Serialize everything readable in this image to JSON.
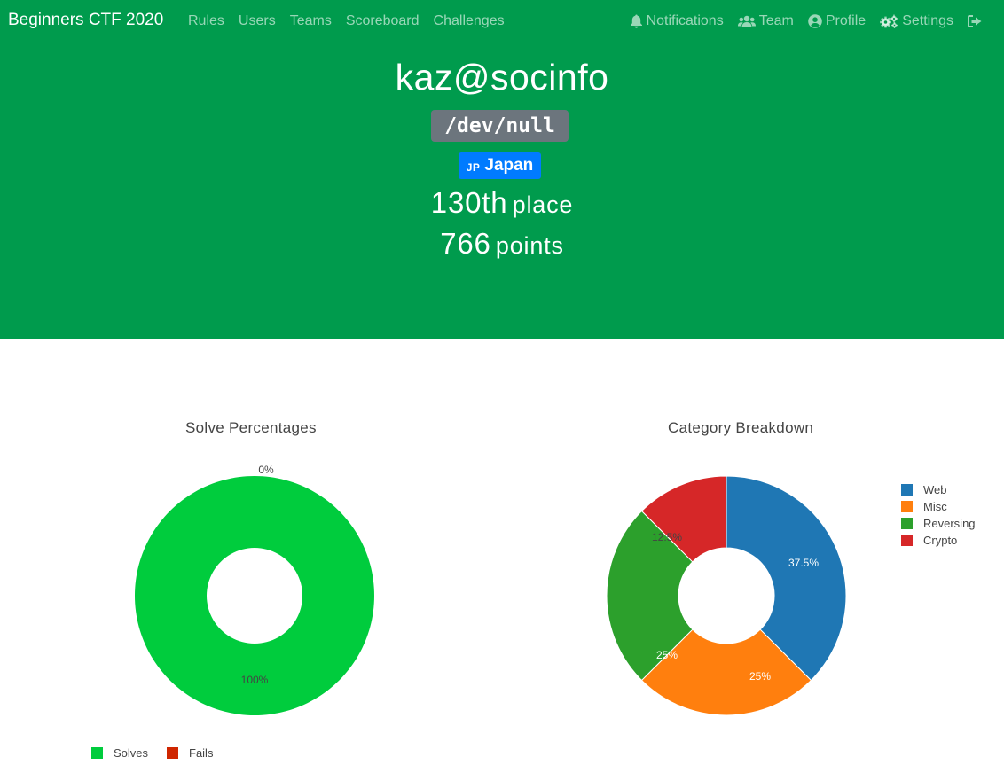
{
  "colors": {
    "header_bg": "#009b4d",
    "solves": "#00cc3d",
    "fails": "#cf2600",
    "web": "#1f77b4",
    "misc": "#ff7f0e",
    "reversing": "#2ca02c",
    "crypto": "#d62728"
  },
  "navbar": {
    "brand": "Beginners CTF 2020",
    "links": [
      "Rules",
      "Users",
      "Teams",
      "Scoreboard",
      "Challenges"
    ],
    "notifications": "Notifications",
    "team": "Team",
    "profile": "Profile",
    "settings": "Settings",
    "icons": [
      "bell-icon",
      "users-icon",
      "user-circle-icon",
      "cogs-icon",
      "logout-icon"
    ]
  },
  "profile": {
    "username": "kaz@socinfo",
    "team": "/dev/null",
    "country_code": "JP",
    "country": "Japan",
    "place_number": "130th",
    "place_word": "place",
    "points_number": "766",
    "points_word": "points"
  },
  "chart_data": [
    {
      "type": "pie",
      "title": "Solve Percentages",
      "hole": true,
      "labels": [
        "Solves",
        "Fails"
      ],
      "values": [
        100,
        0
      ],
      "text_labels": [
        "100%",
        "0%"
      ],
      "legend": "bottom-left"
    },
    {
      "type": "pie",
      "title": "Category Breakdown",
      "hole": true,
      "labels": [
        "Web",
        "Misc",
        "Reversing",
        "Crypto"
      ],
      "values": [
        37.5,
        25,
        25,
        12.5
      ],
      "text_labels": [
        "37.5%",
        "25%",
        "25%",
        "12.5%"
      ],
      "legend": "top-right"
    }
  ]
}
